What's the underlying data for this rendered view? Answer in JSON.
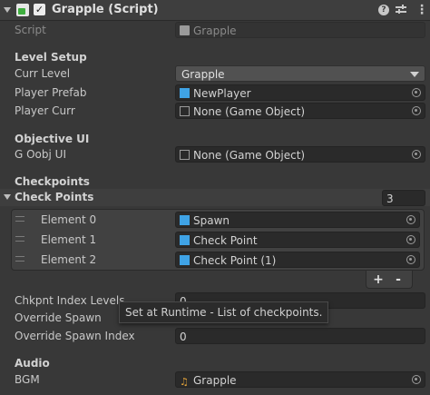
{
  "header": {
    "title": "Grapple (Script)",
    "enabled": true,
    "icons": [
      "script-icon",
      "help-icon",
      "presets-icon",
      "more-menu-icon"
    ]
  },
  "script": {
    "label": "Script",
    "value": "Grapple"
  },
  "level_setup": {
    "heading": "Level Setup",
    "curr_level_label": "Curr Level",
    "curr_level_value": "Grapple",
    "player_prefab_label": "Player Prefab",
    "player_prefab_value": "NewPlayer",
    "player_curr_label": "Player Curr",
    "player_curr_value": "None (Game Object)"
  },
  "objective_ui": {
    "heading": "Objective UI",
    "g_oobj_label": "G Oobj UI",
    "g_oobj_value": "None (Game Object)"
  },
  "checkpoints": {
    "heading": "Checkpoints",
    "list_label": "Check Points",
    "count": "3",
    "elements": [
      {
        "label": "Element 0",
        "value": "Spawn"
      },
      {
        "label": "Element 1",
        "value": "Check Point"
      },
      {
        "label": "Element 2",
        "value": "Check Point (1)"
      }
    ],
    "add_label": "+",
    "remove_label": "-"
  },
  "fields": {
    "index_levels_label": "Chkpnt Index Levels",
    "index_levels_value": "0",
    "override_spawn_label": "Override Spawn",
    "override_spawn_index_label": "Override Spawn Index",
    "override_spawn_index_value": "0"
  },
  "tooltip": "Set at Runtime - List of checkpoints.",
  "audio": {
    "heading": "Audio",
    "bgm_label": "BGM",
    "bgm_value": "Grapple"
  },
  "colors": {
    "background": "#383838",
    "header": "#3e3e3e",
    "field": "#2a2a2a",
    "prefab_icon": "#3fa3e6",
    "audio_icon": "#e3a33a"
  }
}
